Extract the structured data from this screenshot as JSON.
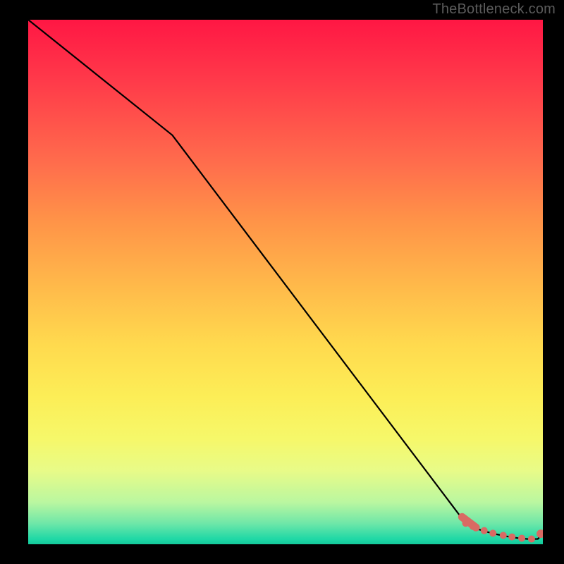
{
  "watermark": "TheBottleneck.com",
  "chart_data": {
    "type": "line",
    "title": "",
    "xlabel": "",
    "ylabel": "",
    "xlim": [
      0,
      100
    ],
    "ylim": [
      0,
      100
    ],
    "series": [
      {
        "name": "bottleneck-curve",
        "x": [
          0,
          28,
          85,
          87,
          89,
          91,
          93,
          95,
          97,
          99,
          100
        ],
        "y": [
          100,
          78,
          4,
          3,
          2.4,
          1.9,
          1.5,
          1.2,
          1.0,
          1.0,
          2.0
        ]
      }
    ],
    "markers": {
      "name": "optimal-region-dots",
      "color": "#d96a63",
      "x": [
        85.0,
        86.4,
        88.6,
        90.3,
        92.3,
        94.0,
        95.9,
        97.8,
        99.6
      ],
      "y": [
        4.0,
        3.4,
        2.6,
        2.1,
        1.7,
        1.4,
        1.15,
        1.0,
        2.0
      ],
      "r": [
        5,
        5,
        5,
        5,
        5,
        5,
        5,
        5,
        6
      ]
    },
    "thick_segment": {
      "name": "optimal-region-band",
      "color": "#d96a63",
      "x": [
        84.3,
        87.0
      ],
      "y": [
        5.2,
        3.2
      ]
    }
  }
}
